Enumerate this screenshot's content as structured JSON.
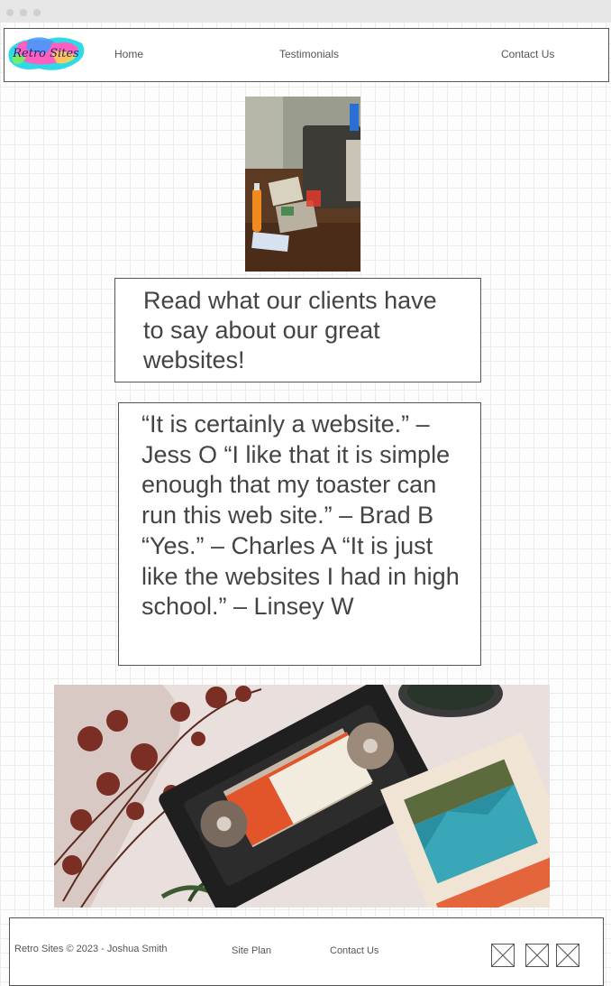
{
  "header": {
    "logo_text": "Retro Sites",
    "nav": [
      {
        "label": "Home"
      },
      {
        "label": "Testimonials"
      },
      {
        "label": "Contact Us"
      }
    ]
  },
  "intro": {
    "text": "Read what our clients have to say about our great websites!"
  },
  "testimonials": {
    "text": "“It is certainly a website.” – Jess O “I like that it is simple enough that my toaster can run this web site.” – Brad B “Yes.” – Charles A “It is just like the websites I had in high school.” – Linsey W"
  },
  "footer": {
    "copyright": "Retro Sites © 2023 - Joshua Smith",
    "links": [
      {
        "label": "Site Plan"
      },
      {
        "label": "Contact Us"
      }
    ],
    "social_icons": [
      "image-placeholder-icon",
      "image-placeholder-icon",
      "image-placeholder-icon"
    ]
  },
  "colors": {
    "border": "#555555",
    "text": "#444444",
    "background": "#fdfdfd"
  }
}
